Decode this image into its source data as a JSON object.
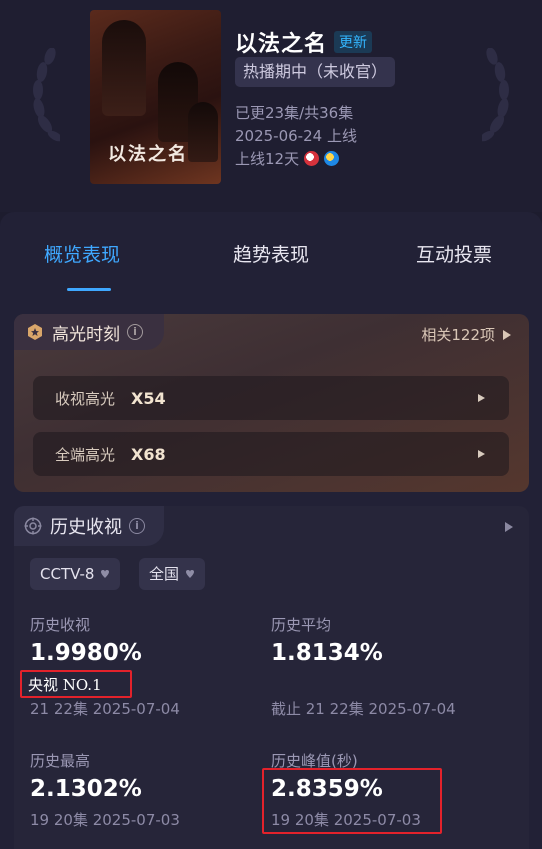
{
  "header": {
    "show_title": "以法之名",
    "update_badge": "更新",
    "status": "热播期中（未收官）",
    "episodes": "已更23集/共36集",
    "premiere_date": "2025-06-24 上线",
    "days_online": "上线12天",
    "poster_title": "以法之名",
    "platform_icons": [
      "cctv-logo-icon",
      "streaming-logo-icon"
    ]
  },
  "tabs": [
    {
      "label": "概览表现",
      "active": true
    },
    {
      "label": "趋势表现",
      "active": false
    },
    {
      "label": "互动投票",
      "active": false
    }
  ],
  "highlights": {
    "title": "高光时刻",
    "count_label": "相关122项",
    "rows": [
      {
        "label": "收视高光",
        "value": "X54"
      },
      {
        "label": "全端高光",
        "value": "X68"
      }
    ]
  },
  "history": {
    "title": "历史收视",
    "channel_select": "CCTV-8",
    "region_select": "全国",
    "stats": {
      "rating_label": "历史收视",
      "rating_value": "1.9980%",
      "rating_rank": "央视 NO.1",
      "rating_sub": "21 22集 2025-07-04",
      "avg_label": "历史平均",
      "avg_value": "1.8134%",
      "avg_sub": "截止 21 22集 2025-07-04",
      "max_label": "历史最高",
      "max_value": "2.1302%",
      "max_sub": "19 20集 2025-07-03",
      "peak_label": "历史峰值(秒)",
      "peak_value": "2.8359%",
      "peak_sub": "19 20集 2025-07-03"
    }
  },
  "colors": {
    "accent_blue": "#3fa8ff",
    "annotation_red": "#e3222b",
    "background": "#1d1c2e"
  }
}
